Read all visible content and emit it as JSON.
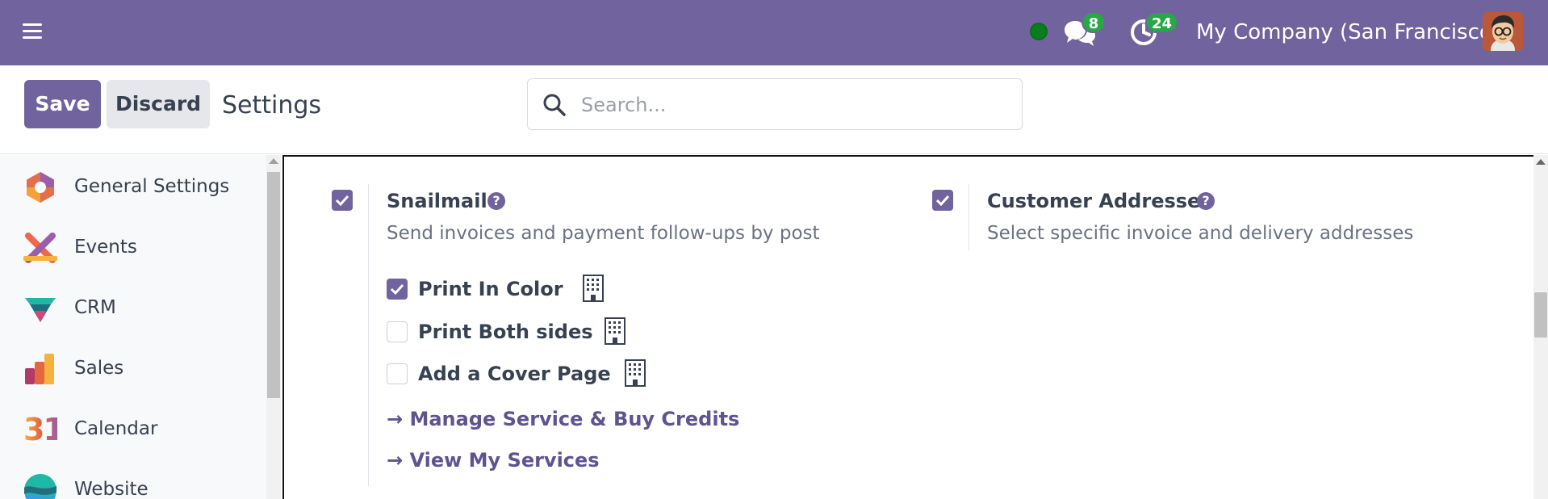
{
  "navbar": {
    "chat_count": "8",
    "activity_count": "24",
    "company": "My Company (San Francisco)",
    "presence_color": "#0a7e1f"
  },
  "control_panel": {
    "save_label": "Save",
    "discard_label": "Discard",
    "title": "Settings",
    "search_placeholder": "Search..."
  },
  "sidebar": {
    "items": [
      {
        "label": "General Settings",
        "icon": "general-settings-icon"
      },
      {
        "label": "Events",
        "icon": "events-icon"
      },
      {
        "label": "CRM",
        "icon": "crm-icon"
      },
      {
        "label": "Sales",
        "icon": "sales-icon"
      },
      {
        "label": "Calendar",
        "icon": "calendar-icon",
        "icon_text": "31"
      },
      {
        "label": "Website",
        "icon": "website-icon"
      }
    ]
  },
  "settings": {
    "snailmail": {
      "title": "Snailmail",
      "description": "Send invoices and payment follow-ups by post",
      "enabled": true,
      "options": [
        {
          "label": "Print In Color",
          "checked": true
        },
        {
          "label": "Print Both sides",
          "checked": false
        },
        {
          "label": "Add a Cover Page",
          "checked": false
        }
      ],
      "links": [
        {
          "label": "→ Manage Service & Buy Credits"
        },
        {
          "label": "→ View My Services"
        }
      ]
    },
    "customer_addresses": {
      "title": "Customer Addresses",
      "description": "Select specific invoice and delivery addresses",
      "enabled": true
    }
  },
  "colors": {
    "brand": "#71639e",
    "badge": "#28a745",
    "link": "#5f5390"
  }
}
